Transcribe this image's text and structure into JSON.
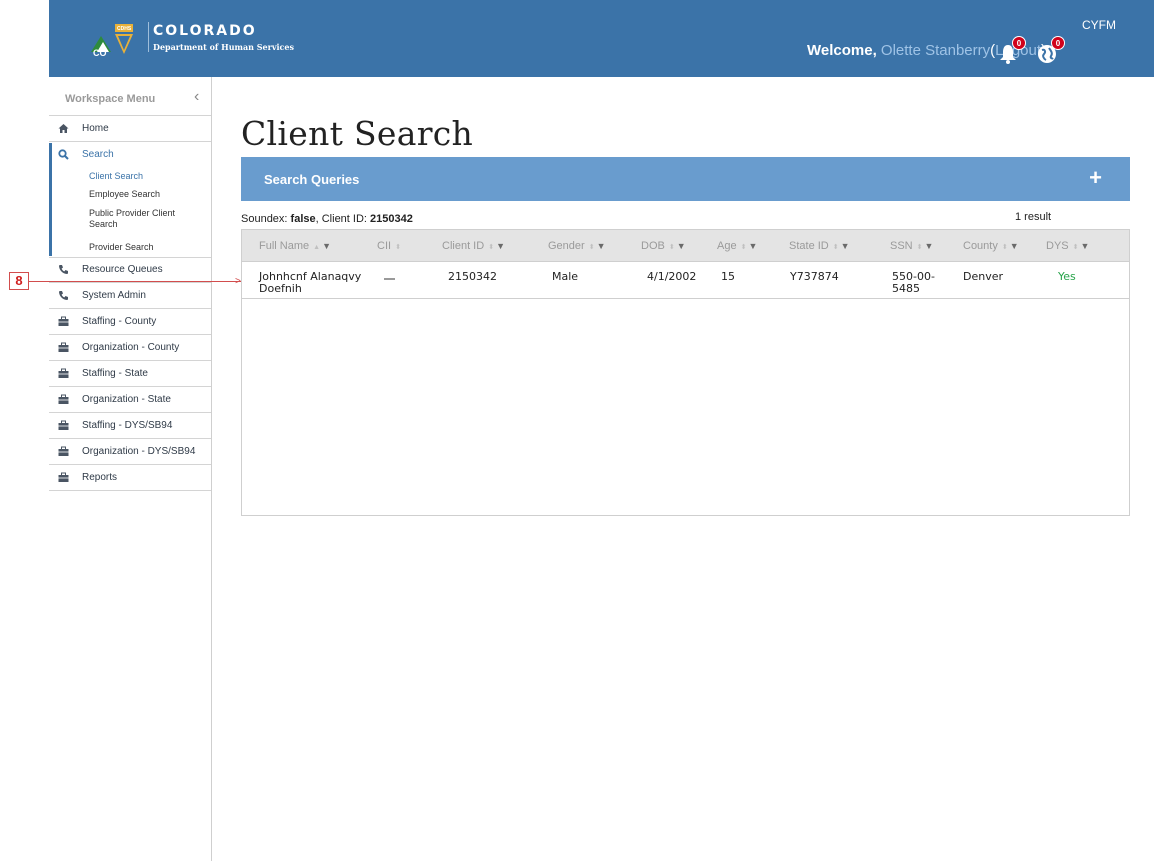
{
  "header": {
    "brand_title": "COLORADO",
    "brand_subtitle": "Department of Human Services",
    "logo_text": "CO",
    "logo_badge": "CDHS",
    "app_code": "CYFM",
    "welcome_label": "Welcome,",
    "user_name": "Olette Stanberry",
    "logout_label": "Logout",
    "notifications_count": "0",
    "globe_count": "0"
  },
  "sidebar": {
    "title": "Workspace Menu",
    "items": [
      {
        "label": "Home",
        "icon": "home-icon"
      },
      {
        "label": "Search",
        "icon": "search-icon"
      },
      {
        "label": "Resource Queues",
        "icon": "phone-icon"
      },
      {
        "label": "System Admin",
        "icon": "phone-icon"
      },
      {
        "label": "Staffing - County",
        "icon": "briefcase-icon"
      },
      {
        "label": "Organization - County",
        "icon": "briefcase-icon"
      },
      {
        "label": "Staffing - State",
        "icon": "briefcase-icon"
      },
      {
        "label": "Organization - State",
        "icon": "briefcase-icon"
      },
      {
        "label": "Staffing - DYS/SB94",
        "icon": "briefcase-icon"
      },
      {
        "label": "Organization - DYS/SB94",
        "icon": "briefcase-icon"
      },
      {
        "label": "Reports",
        "icon": "briefcase-icon"
      }
    ],
    "search_subitems": [
      {
        "label": "Client Search"
      },
      {
        "label": "Employee Search"
      },
      {
        "label": "Public Provider Client Search"
      },
      {
        "label": "Provider Search"
      }
    ]
  },
  "callout": {
    "number": "8"
  },
  "main": {
    "page_title": "Client Search",
    "search_queries_label": "Search Queries",
    "add_symbol": "+",
    "query_soundex_label": "Soundex:",
    "query_soundex_value": "false",
    "query_client_label": ", Client ID:",
    "query_client_value": "2150342",
    "result_count": "1 result"
  },
  "table": {
    "columns": [
      "Full Name",
      "CII",
      "Client ID",
      "Gender",
      "DOB",
      "Age",
      "State ID",
      "SSN",
      "County",
      "DYS"
    ],
    "rows": [
      {
        "full_name_line1": "Johnhcnf Alanaqvy",
        "full_name_line2": "Doefnih",
        "cii": "",
        "client_id": "2150342",
        "gender": "Male",
        "dob": "4/1/2002",
        "age": "15",
        "state_id": "Y737874",
        "ssn_line1": "550-00-",
        "ssn_line2": "5485",
        "county": "Denver",
        "dys": "Yes"
      }
    ]
  },
  "colors": {
    "header_bg": "#3b73a8",
    "search_bar_bg": "#699cce",
    "dys_yes": "#27a34a",
    "badge_red": "#d0021b"
  }
}
